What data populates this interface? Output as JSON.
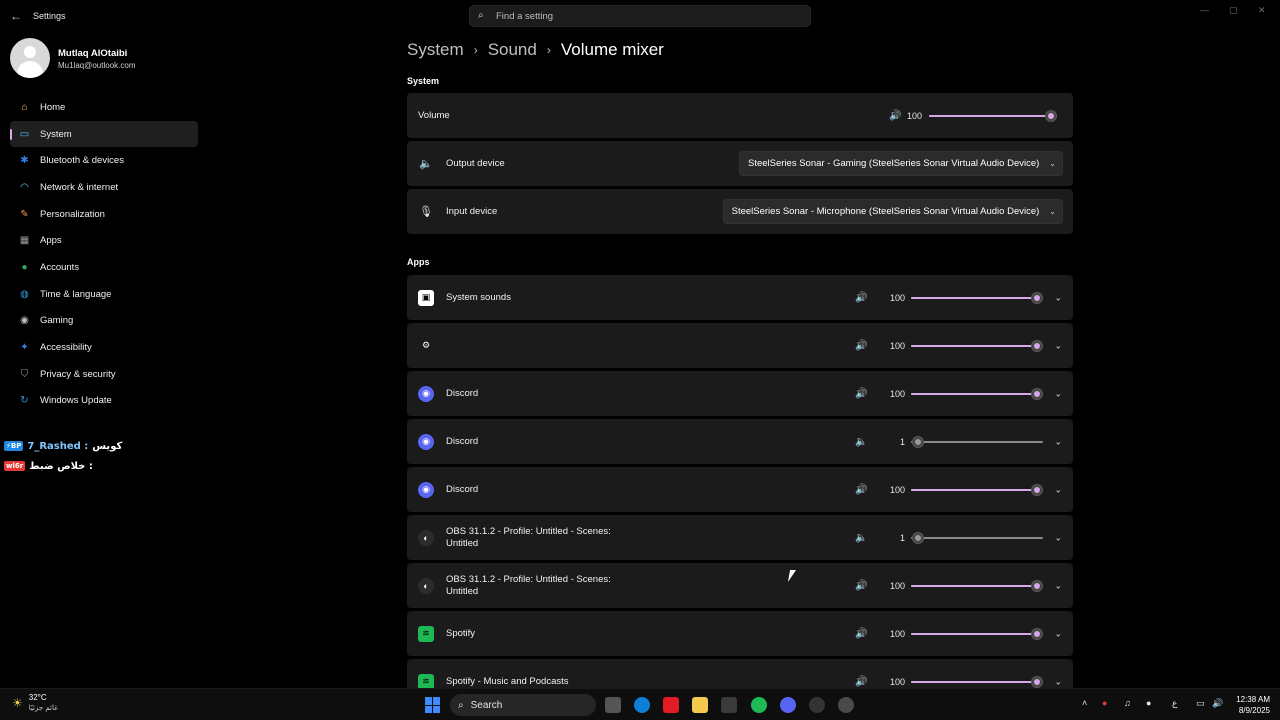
{
  "window": {
    "title": "Settings",
    "back_glyph": "←",
    "controls": [
      "—",
      "▢",
      "✕"
    ]
  },
  "search": {
    "placeholder": "Find a setting",
    "icon": "search-icon"
  },
  "profile": {
    "name": "Mutlaq AlOtaibi",
    "email": "Mu1laq@outlook.com"
  },
  "nav": {
    "items": [
      {
        "label": "Home",
        "icon": "home-icon",
        "color": "#f2c94c"
      },
      {
        "label": "System",
        "icon": "system-icon",
        "color": "#4fc3f7"
      },
      {
        "label": "Bluetooth & devices",
        "icon": "bluetooth-icon",
        "color": "#2f80ed"
      },
      {
        "label": "Network & internet",
        "icon": "wifi-icon",
        "color": "#56ccf2"
      },
      {
        "label": "Personalization",
        "icon": "brush-icon",
        "color": "#f2994a"
      },
      {
        "label": "Apps",
        "icon": "apps-icon",
        "color": "#9e9e9e"
      },
      {
        "label": "Accounts",
        "icon": "account-icon",
        "color": "#27ae60"
      },
      {
        "label": "Time & language",
        "icon": "globe-icon",
        "color": "#2d9cdb"
      },
      {
        "label": "Gaming",
        "icon": "gamepad-icon",
        "color": "#bdbdbd"
      },
      {
        "label": "Accessibility",
        "icon": "accessibility-icon",
        "color": "#2f80ed"
      },
      {
        "label": "Privacy & security",
        "icon": "shield-icon",
        "color": "#9e9e9e"
      },
      {
        "label": "Windows Update",
        "icon": "update-icon",
        "color": "#2d9cdb"
      }
    ],
    "active_index": 1
  },
  "chat": {
    "lines": [
      {
        "badge": "⚡BP",
        "name": "7_Rashed :",
        "msg": "كويس"
      },
      {
        "badge": "wl6r",
        "name": "",
        "msg": "خلاص ضبط :"
      }
    ]
  },
  "breadcrumb": {
    "items": [
      "System",
      "Sound",
      "Volume mixer"
    ],
    "separator": "›"
  },
  "system_section": {
    "heading": "System",
    "volume": {
      "label": "Volume",
      "value": "100",
      "level": 1.0
    },
    "output": {
      "label": "Output device",
      "value": "SteelSeries Sonar - Gaming (SteelSeries Sonar Virtual Audio Device)"
    },
    "input": {
      "label": "Input device",
      "value": "SteelSeries Sonar - Microphone (SteelSeries Sonar Virtual Audio Device)"
    }
  },
  "apps_section": {
    "heading": "Apps",
    "apps": [
      {
        "name": "System sounds",
        "icon": "speaker-box-icon",
        "value": "100",
        "level": 1.0,
        "muted_icon": false
      },
      {
        "name": "",
        "icon": "steelseries-icon",
        "value": "100",
        "level": 1.0,
        "muted_icon": false
      },
      {
        "name": "Discord",
        "icon": "discord-icon",
        "value": "100",
        "level": 1.0,
        "muted_icon": false
      },
      {
        "name": "Discord",
        "icon": "discord-icon",
        "value": "1",
        "level": 0.01,
        "muted_icon": true
      },
      {
        "name": "Discord",
        "icon": "discord-icon",
        "value": "100",
        "level": 1.0,
        "muted_icon": false
      },
      {
        "name": "OBS 31.1.2 - Profile: Untitled - Scenes: Untitled",
        "icon": "obs-icon",
        "value": "1",
        "level": 0.01,
        "muted_icon": true
      },
      {
        "name": "OBS 31.1.2 - Profile: Untitled - Scenes: Untitled",
        "icon": "obs-icon",
        "value": "100",
        "level": 1.0,
        "muted_icon": false
      },
      {
        "name": "Spotify",
        "icon": "spotify-icon",
        "value": "100",
        "level": 1.0,
        "muted_icon": false
      },
      {
        "name": "Spotify - Music and Podcasts",
        "icon": "spotify-icon",
        "value": "100",
        "level": 1.0,
        "muted_icon": false
      }
    ]
  },
  "taskbar": {
    "weather_temp": "32°C",
    "weather_desc": "غائم جزئيًا",
    "search_label": "Search",
    "time": "12:38 AM",
    "date": "8/9/2025"
  },
  "colors": {
    "accent": "#d7a6e4",
    "card": "#1b1b1b",
    "background": "#000000"
  }
}
